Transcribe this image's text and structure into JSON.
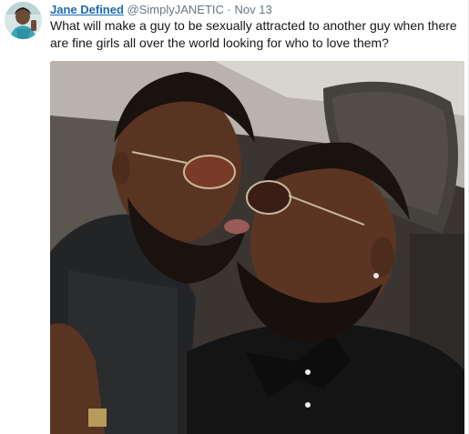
{
  "tweet": {
    "author": {
      "display_name": "Jane Defined",
      "handle": "@SimplyJANETIC",
      "avatar_icon": "profile-avatar"
    },
    "separator": "·",
    "timestamp": "Nov 13",
    "text": "What will make a guy to be sexually attracted to another guy when there are fine girls all over the world looking for who to love them?",
    "media": {
      "type": "photo"
    }
  },
  "colors": {
    "name_link": "#1b6cb3",
    "meta_gray": "#657786",
    "text": "#14171a"
  }
}
